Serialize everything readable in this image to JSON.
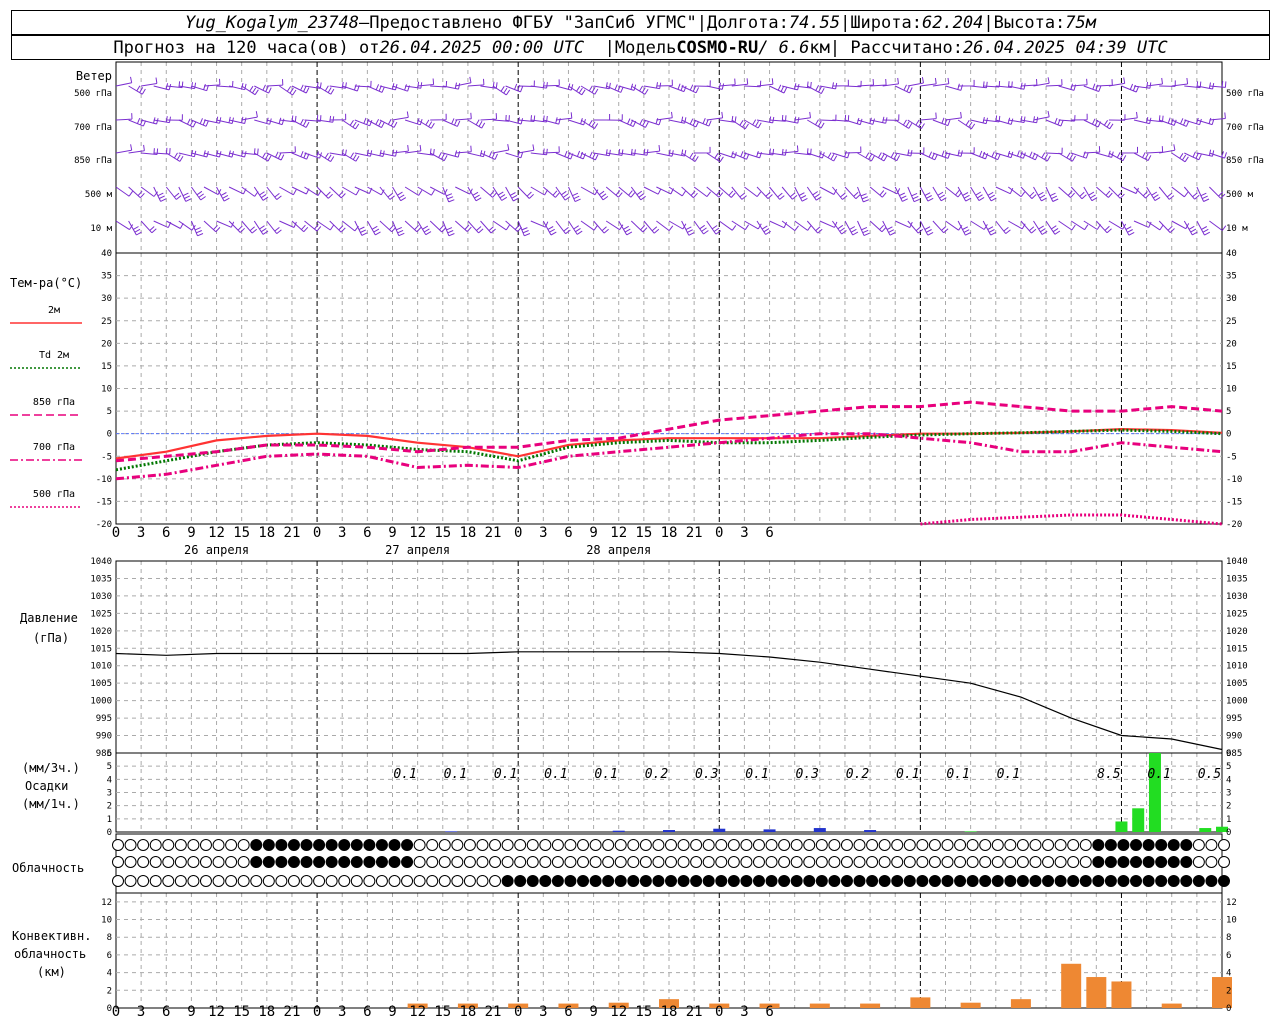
{
  "header": {
    "station": "Yug_Kogalym_23748",
    "dash": " — ",
    "provider": "Предоставлено ФГБУ \"ЗапСиб УГМС\"",
    "sep": " | ",
    "lon_label": "Долгота: ",
    "lon_value": "74.55",
    "lat_label": "Широта: ",
    "lat_value": "62.204",
    "alt_label": "Высота: ",
    "alt_value": "75м"
  },
  "subheader": {
    "forecast_prefix": "Прогноз на 120 часа(ов) от ",
    "forecast_time": "26.04.2025 00:00 UTC",
    "model_label": "|Модель ",
    "model_name": "COSMO-RU",
    "model_res": " / 6.6",
    "model_unit": "км",
    "calc_label": " | Рассчитано: ",
    "calc_time": "26.04.2025 04:39 UTC"
  },
  "wind_panel": {
    "title": "Ветер",
    "levels": [
      "500 гПа",
      "700 гПа",
      "850 гПа",
      "500 м",
      "10   м"
    ]
  },
  "temp_panel": {
    "title": "Тем-ра(°C)",
    "legend": [
      {
        "label": "2м",
        "color": "#ff3333",
        "style": "solid"
      },
      {
        "label": "Td  2м",
        "color": "#007700",
        "style": "dotted"
      },
      {
        "label": "850 гПа",
        "color": "#e8007d",
        "style": "dashed"
      },
      {
        "label": "700 гПа",
        "color": "#e8007d",
        "style": "dashdot"
      },
      {
        "label": "500 гПа",
        "color": "#e8007d",
        "style": "dotted"
      }
    ],
    "y_ticks": [
      40,
      35,
      30,
      25,
      20,
      15,
      10,
      5,
      0,
      -5,
      -10,
      -15,
      -20
    ]
  },
  "pressure_panel": {
    "title": "Давление",
    "unit": "(гПа)",
    "y_ticks": [
      1040,
      1035,
      1030,
      1025,
      1020,
      1015,
      1010,
      1005,
      1000,
      995,
      990,
      985
    ]
  },
  "precip_panel": {
    "unit3": "(мм/3ч.)",
    "title": "Осадки",
    "unit1": "(мм/1ч.)",
    "y_ticks": [
      6,
      5,
      4,
      3,
      2,
      1,
      0
    ],
    "amounts": [
      {
        "h": 36,
        "v": "0.1"
      },
      {
        "h": 42,
        "v": "0.1"
      },
      {
        "h": 48,
        "v": "0.1"
      },
      {
        "h": 54,
        "v": "0.1"
      },
      {
        "h": 60,
        "v": "0.1"
      },
      {
        "h": 66,
        "v": "0.2"
      },
      {
        "h": 72,
        "v": "0.3"
      },
      {
        "h": 78,
        "v": "0.1"
      },
      {
        "h": 84,
        "v": "0.3"
      },
      {
        "h": 90,
        "v": "0.2"
      },
      {
        "h": 96,
        "v": "0.1"
      },
      {
        "h": 102,
        "v": "0.1"
      },
      {
        "h": 108,
        "v": "0.1"
      },
      {
        "h": 120,
        "v": "8.5"
      },
      {
        "h": 126,
        "v": "0.1"
      },
      {
        "h": 132,
        "v": "0.5"
      }
    ]
  },
  "cloud_panel": {
    "title": "Облачность"
  },
  "conv_panel": {
    "title1": "Конвективн.",
    "title2": "облачность",
    "unit": "(км)",
    "y_ticks": [
      12,
      10,
      8,
      6,
      4,
      2,
      0
    ]
  },
  "x_axis": {
    "hour_labels": [
      "0",
      "3",
      "6",
      "9",
      "12",
      "15",
      "18",
      "21",
      "0",
      "3",
      "6",
      "9",
      "12",
      "15",
      "18",
      "21",
      "0",
      "3",
      "6",
      "9",
      "12",
      "15",
      "18",
      "21",
      "0",
      "3",
      "6"
    ],
    "dates": [
      "26 апреля",
      "27 апреля",
      "28 апреля"
    ]
  },
  "chart_data": {
    "type": "line",
    "x_unit": "hours since 26.04.2025 00:00 UTC",
    "temperature": {
      "ylim": [
        -20,
        40
      ],
      "series": [
        {
          "name": "2м",
          "x": [
            0,
            6,
            12,
            18,
            24,
            30,
            36,
            42,
            48,
            54,
            60,
            66,
            72,
            78,
            84,
            90,
            96,
            102,
            108,
            114,
            120,
            126,
            132
          ],
          "values": [
            -5.5,
            -4,
            -1.5,
            -0.5,
            0,
            -0.5,
            -2,
            -3,
            -5,
            -2.5,
            -1.5,
            -1,
            -1,
            -1,
            -1,
            -0.5,
            0,
            0,
            0.2,
            0.5,
            1,
            0.8,
            0.2
          ]
        },
        {
          "name": "Td  2м",
          "x": [
            0,
            6,
            12,
            18,
            24,
            30,
            36,
            42,
            48,
            54,
            60,
            66,
            72,
            78,
            84,
            90,
            96,
            102,
            108,
            114,
            120,
            126,
            132
          ],
          "values": [
            -8,
            -6,
            -4,
            -2.5,
            -2,
            -2.5,
            -3.5,
            -4,
            -6,
            -3,
            -2,
            -1.5,
            -2,
            -2,
            -1.5,
            -0.8,
            -0.3,
            0,
            0.2,
            0.5,
            0.8,
            0.5,
            0
          ]
        },
        {
          "name": "850 гПа",
          "x": [
            0,
            6,
            12,
            18,
            24,
            30,
            36,
            42,
            48,
            54,
            60,
            66,
            72,
            78,
            84,
            90,
            96,
            102,
            108,
            114,
            120,
            126,
            132
          ],
          "values": [
            -6,
            -5,
            -4,
            -2.5,
            -2.5,
            -3,
            -4,
            -3,
            -3,
            -1.5,
            -1,
            1,
            3,
            4,
            5,
            6,
            6,
            7,
            6,
            5,
            5,
            6,
            5
          ]
        },
        {
          "name": "700 гПа",
          "x": [
            0,
            6,
            12,
            18,
            24,
            30,
            36,
            42,
            48,
            54,
            60,
            66,
            72,
            78,
            84,
            90,
            96,
            102,
            108,
            114,
            120,
            126,
            132
          ],
          "values": [
            -10,
            -9,
            -7,
            -5,
            -4.5,
            -5,
            -7.5,
            -7,
            -7.5,
            -5,
            -4,
            -3,
            -2,
            -1,
            0,
            0,
            -1,
            -2,
            -4,
            -4,
            -2,
            -3,
            -4
          ]
        },
        {
          "name": "500 гПа",
          "x": [
            96,
            102,
            108,
            114,
            120,
            126,
            132
          ],
          "values": [
            -20,
            -19,
            -18.5,
            -18,
            -18,
            -19,
            -20
          ]
        }
      ]
    },
    "pressure": {
      "ylim": [
        985,
        1040
      ],
      "x": [
        0,
        6,
        12,
        18,
        24,
        30,
        36,
        42,
        48,
        54,
        60,
        66,
        72,
        78,
        84,
        90,
        96,
        102,
        108,
        114,
        120,
        126,
        132
      ],
      "values": [
        1013.5,
        1013,
        1013.5,
        1013.5,
        1013.5,
        1013.5,
        1013.5,
        1013.5,
        1014,
        1014,
        1014,
        1014,
        1013.5,
        1012.5,
        1011,
        1009,
        1007,
        1005,
        1001,
        995,
        990,
        989,
        986
      ]
    },
    "convective_cloud_km": {
      "ylim": [
        0,
        13
      ],
      "x": [
        36,
        42,
        48,
        54,
        60,
        66,
        72,
        78,
        84,
        90,
        96,
        102,
        108,
        114,
        117,
        120,
        126,
        132
      ],
      "values": [
        0.5,
        0.5,
        0.5,
        0.5,
        0.6,
        1,
        0.5,
        0.5,
        0.5,
        0.5,
        1.2,
        0.6,
        1,
        5,
        3.5,
        3,
        0.5,
        3.5
      ]
    }
  }
}
